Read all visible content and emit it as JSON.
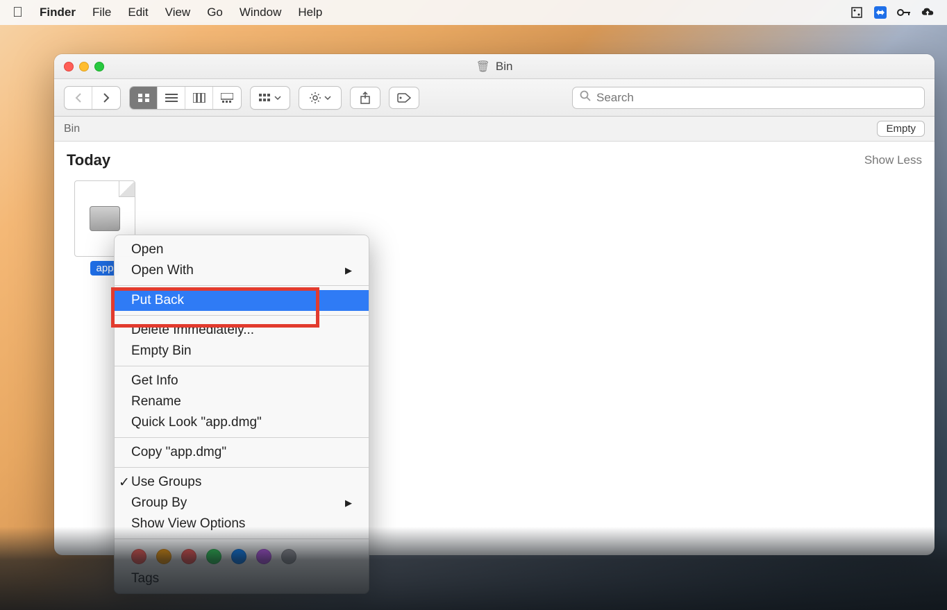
{
  "menubar": {
    "app_name": "Finder",
    "items": [
      "File",
      "Edit",
      "View",
      "Go",
      "Window",
      "Help"
    ]
  },
  "window": {
    "title": "Bin",
    "path": "Bin",
    "empty_button": "Empty",
    "search_placeholder": "Search",
    "section_title": "Today",
    "show_less": "Show Less",
    "file": {
      "label": "app"
    }
  },
  "context_menu": {
    "open": "Open",
    "open_with": "Open With",
    "put_back": "Put Back",
    "delete_immediately": "Delete Immediately...",
    "empty_bin": "Empty Bin",
    "get_info": "Get Info",
    "rename": "Rename",
    "quick_look": "Quick Look \"app.dmg\"",
    "copy": "Copy \"app.dmg\"",
    "use_groups": "Use Groups",
    "group_by": "Group By",
    "show_view_options": "Show View Options",
    "tags_label": "Tags",
    "tag_colors": [
      "#ff5f57",
      "#ff9f0a",
      "#ff5a55",
      "#30d158",
      "#0a84ff",
      "#bf5af2",
      "#98989d"
    ]
  }
}
